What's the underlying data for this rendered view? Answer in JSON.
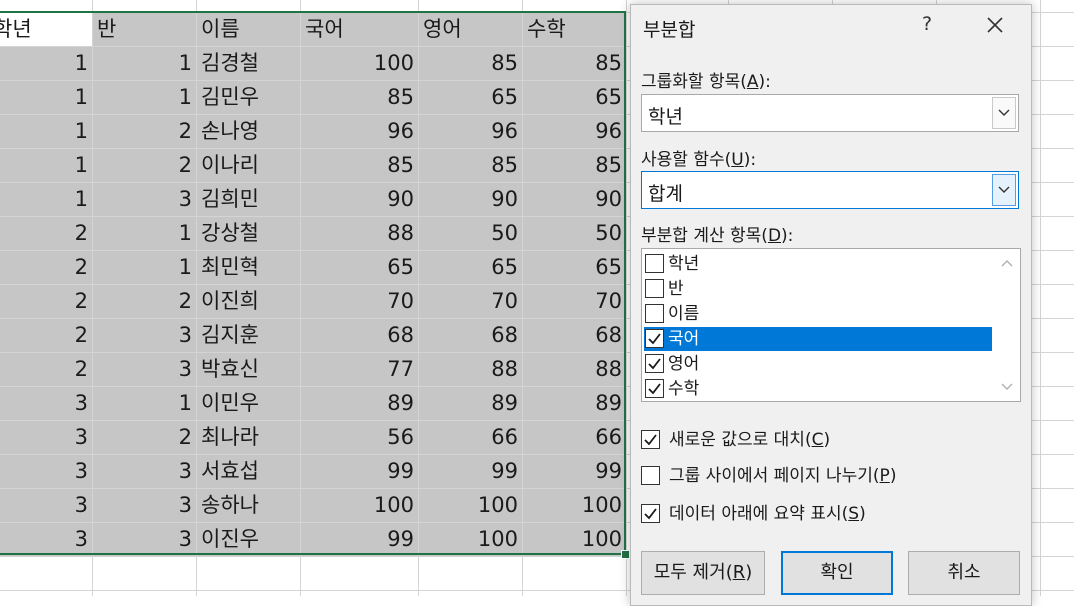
{
  "sheet": {
    "headers": [
      "학년",
      "반",
      "이름",
      "국어",
      "영어",
      "수학"
    ],
    "rows": [
      [
        "1",
        "1",
        "김경철",
        "100",
        "85",
        "85"
      ],
      [
        "1",
        "1",
        "김민우",
        "85",
        "65",
        "65"
      ],
      [
        "1",
        "2",
        "손나영",
        "96",
        "96",
        "96"
      ],
      [
        "1",
        "2",
        "이나리",
        "85",
        "85",
        "85"
      ],
      [
        "1",
        "3",
        "김희민",
        "90",
        "90",
        "90"
      ],
      [
        "2",
        "1",
        "강상철",
        "88",
        "50",
        "50"
      ],
      [
        "2",
        "1",
        "최민혁",
        "65",
        "65",
        "65"
      ],
      [
        "2",
        "2",
        "이진희",
        "70",
        "70",
        "70"
      ],
      [
        "2",
        "3",
        "김지훈",
        "68",
        "68",
        "68"
      ],
      [
        "2",
        "3",
        "박효신",
        "77",
        "88",
        "88"
      ],
      [
        "3",
        "1",
        "이민우",
        "89",
        "89",
        "89"
      ],
      [
        "3",
        "2",
        "최나라",
        "56",
        "66",
        "66"
      ],
      [
        "3",
        "3",
        "서효섭",
        "99",
        "99",
        "99"
      ],
      [
        "3",
        "3",
        "송하나",
        "100",
        "100",
        "100"
      ],
      [
        "3",
        "3",
        "이진우",
        "99",
        "100",
        "100"
      ]
    ],
    "selection_color": "#c6c6c6",
    "selection_border_color": "#217346"
  },
  "dialog": {
    "title": "부분합",
    "help_label": "?",
    "group_by": {
      "label": "그룹화할 항목",
      "hotkey": "A",
      "value": "학년"
    },
    "function": {
      "label": "사용할 함수",
      "hotkey": "U",
      "value": "합계"
    },
    "columns": {
      "label": "부분합 계산 항목",
      "hotkey": "D",
      "items": [
        {
          "label": "학년",
          "checked": false,
          "selected": false
        },
        {
          "label": "반",
          "checked": false,
          "selected": false
        },
        {
          "label": "이름",
          "checked": false,
          "selected": false
        },
        {
          "label": "국어",
          "checked": true,
          "selected": true
        },
        {
          "label": "영어",
          "checked": true,
          "selected": false
        },
        {
          "label": "수학",
          "checked": true,
          "selected": false
        }
      ]
    },
    "options": [
      {
        "label": "새로운 값으로 대치",
        "hotkey": "C",
        "checked": true
      },
      {
        "label": "그룹 사이에서 페이지 나누기",
        "hotkey": "P",
        "checked": false
      },
      {
        "label": "데이터 아래에 요약 표시",
        "hotkey": "S",
        "checked": true
      }
    ],
    "buttons": {
      "remove_all": {
        "label": "모두 제거",
        "hotkey": "R"
      },
      "ok": "확인",
      "cancel": "취소"
    },
    "accent_color": "#0078d7"
  }
}
